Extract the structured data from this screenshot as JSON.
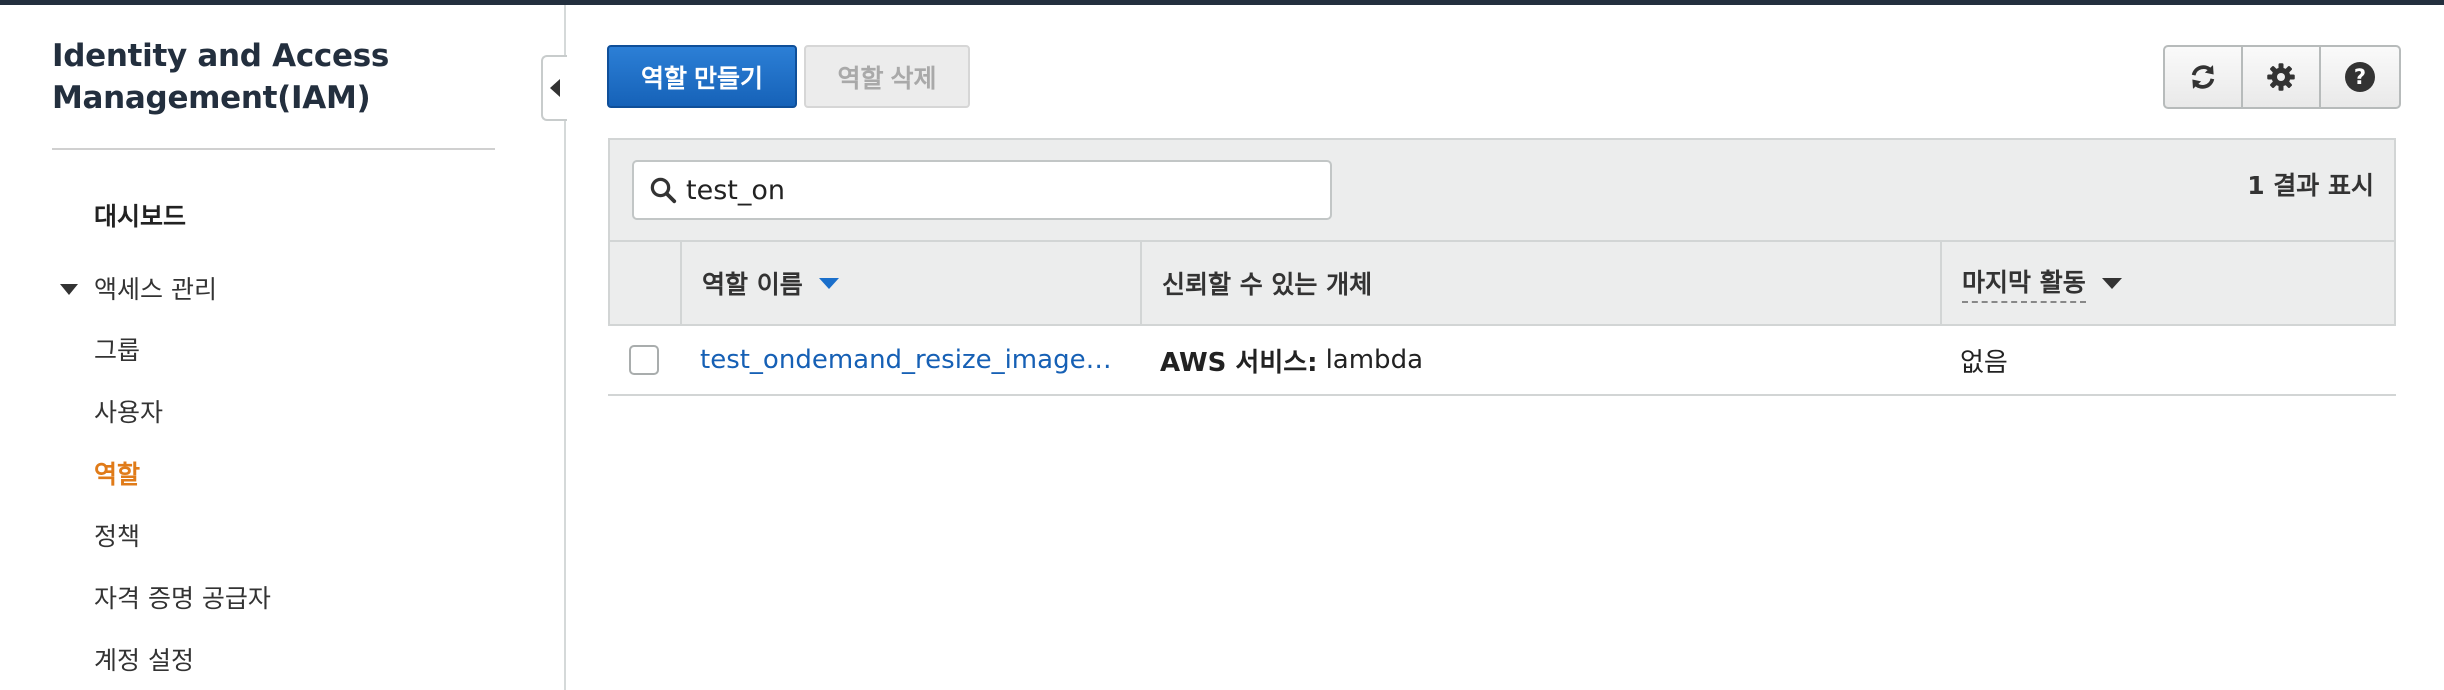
{
  "sidebar": {
    "title_line1": "Identity and Access",
    "title_line2": "Management(IAM)",
    "dashboard": "대시보드",
    "access_mgmt": "액세스 관리",
    "items": [
      "그룹",
      "사용자",
      "역할",
      "정책",
      "자격 증명 공급자",
      "계정 설정"
    ],
    "active_item": "역할"
  },
  "toolbar": {
    "create_role": "역할 만들기",
    "delete_role": "역할 삭제",
    "icons": [
      "refresh-icon",
      "gear-icon",
      "help-icon"
    ],
    "help_glyph": "?"
  },
  "search": {
    "value": "test_on"
  },
  "results": {
    "count_label": "1 결과 표시"
  },
  "table": {
    "headers": [
      "역할 이름",
      "신뢰할 수 있는 개체",
      "마지막 활동"
    ],
    "rows": [
      {
        "role_name": "test_ondemand_resize_image_role",
        "trusted_prefix": "AWS 서비스:",
        "trusted_value": "lambda",
        "last_activity": "없음"
      }
    ]
  },
  "colors": {
    "accent": "#1a6fcb",
    "active_nav": "#e07b19",
    "link": "#1660b5"
  }
}
